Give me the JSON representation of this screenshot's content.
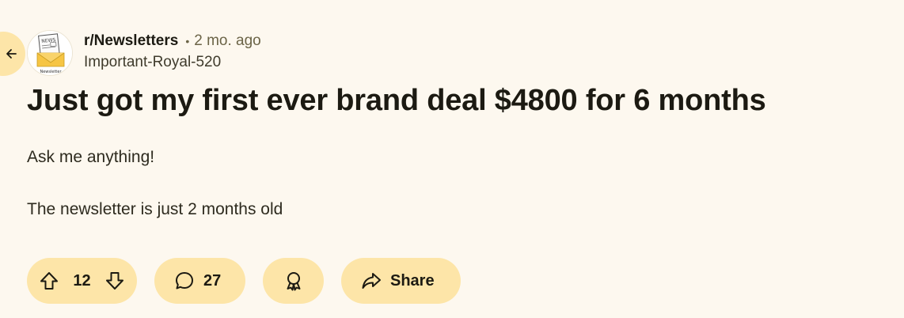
{
  "post": {
    "subreddit": "r/Newsletters",
    "separator": "•",
    "time": "2 mo. ago",
    "author": "Important-Royal-520",
    "avatar_caption": "Newsletter",
    "title": "Just got my first ever brand deal $4800 for 6 months",
    "body": [
      "Ask me anything!",
      "The newsletter is just 2 months old"
    ]
  },
  "actions": {
    "upvotes": "12",
    "comments": "27",
    "share_label": "Share"
  },
  "icons": {
    "back": "arrow-left-icon",
    "upvote": "upvote-arrow-icon",
    "downvote": "downvote-arrow-icon",
    "comment": "comment-bubble-icon",
    "award": "award-ribbon-icon",
    "share": "share-arrow-icon"
  },
  "colors": {
    "background": "#fdf8ef",
    "pill": "#fde5a8",
    "text": "#1c1a12",
    "muted": "#6b6447",
    "envelope": "#f6c544"
  }
}
